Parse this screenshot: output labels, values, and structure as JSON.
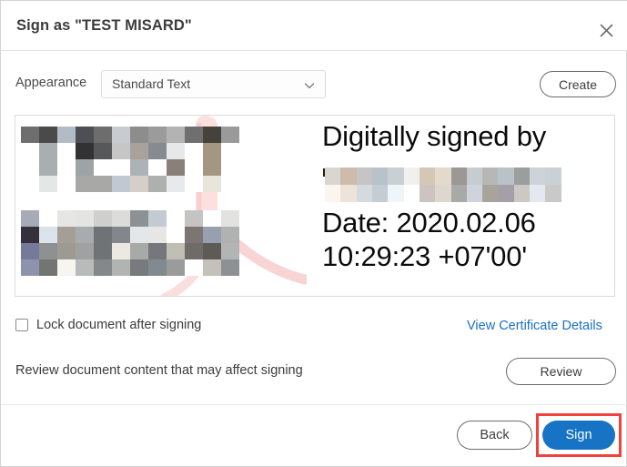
{
  "dialog": {
    "title": "Sign as \"TEST MISARD\"",
    "close_icon": "close-icon"
  },
  "appearance": {
    "label": "Appearance",
    "selected": "Standard Text",
    "placeholder": "Standard Text",
    "options": [
      "Standard Text"
    ],
    "chevron_icon": "chevron-down-icon",
    "create_label": "Create"
  },
  "preview": {
    "line1": "Digitally signed by",
    "line2_redacted": "",
    "line3": "Date: 2020.02.06",
    "line4": "10:29:23 +07'00'",
    "watermark_icon": "quill-pen-watermark-icon"
  },
  "lock": {
    "label": "Lock document after signing",
    "checked": false
  },
  "certificate": {
    "link_label": "View Certificate Details"
  },
  "review": {
    "description": "Review document content that may affect signing",
    "button_label": "Review"
  },
  "footer": {
    "back_label": "Back",
    "sign_label": "Sign"
  },
  "colors": {
    "accent_blue": "#1773c4",
    "link_blue": "#1a6fc4",
    "highlight_red": "#f2413c",
    "text_dark": "#3c3c3c",
    "border_gray": "#6d6d6d",
    "watermark_pink": "#f7cdcd"
  }
}
